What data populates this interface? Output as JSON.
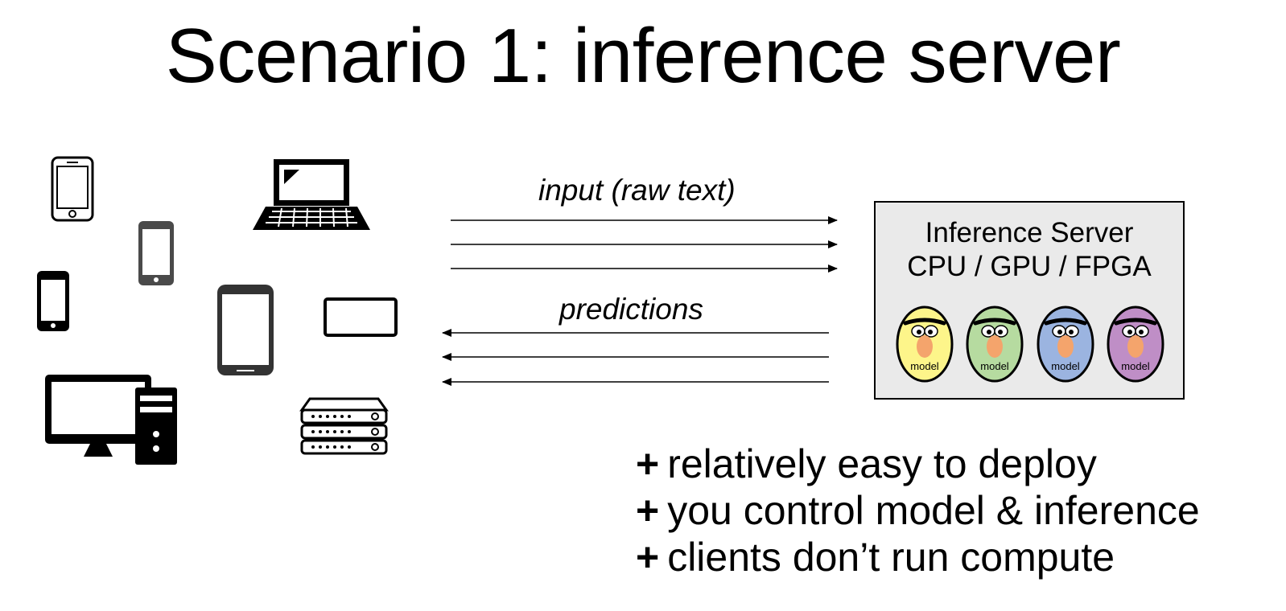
{
  "slide": {
    "title": "Scenario 1: inference server"
  },
  "arrows": {
    "input_label": "input (raw text)",
    "predictions_label": "predictions"
  },
  "server": {
    "line1": "Inference Server",
    "line2": "CPU / GPU / FPGA",
    "model_label": "model",
    "model_colors": [
      "#fdf58a",
      "#b6dba0",
      "#9bb4e0",
      "#bf8ec6"
    ]
  },
  "clients": {
    "icons": [
      "phone-icon",
      "phone-icon",
      "phone-icon",
      "laptop-icon",
      "tablet-icon",
      "tablet-landscape-icon",
      "desktop-computer-icon",
      "server-rack-icon"
    ]
  },
  "bullets": [
    {
      "marker": "+",
      "text": "relatively easy to deploy"
    },
    {
      "marker": "+",
      "text": "you control model & inference"
    },
    {
      "marker": "+",
      "text": "clients don’t run compute"
    }
  ]
}
